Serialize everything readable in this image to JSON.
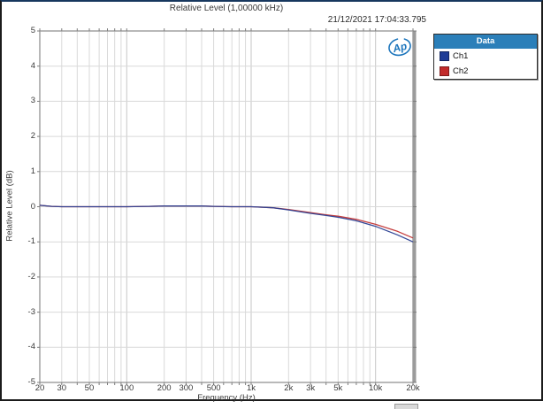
{
  "window": {
    "border_top_color": "#17375e",
    "border_color": "#1b1b1b"
  },
  "header": {
    "title": "Relative Level (1,00000 kHz)",
    "timestamp": "21/12/2021 17:04:33.795"
  },
  "logo": {
    "text": "Ap",
    "color": "#1c75bc"
  },
  "legend": {
    "title": "Data",
    "header_bg": "#2b7fb9",
    "header_color": "#ffffff",
    "items": [
      {
        "label": "Ch1",
        "color": "#1e3c96"
      },
      {
        "label": "Ch2",
        "color": "#c22a2a"
      }
    ]
  },
  "chart_data": {
    "type": "line",
    "title": "Relative Level (1,00000 kHz)",
    "xlabel": "Frequency (Hz)",
    "ylabel": "Relative Level (dB)",
    "x_scale": "log",
    "xlim": [
      20,
      20000
    ],
    "ylim": [
      -5,
      5
    ],
    "grid": true,
    "grid_color": "#d9d9d9",
    "decade_grid_color": "#c6c6c6",
    "frame_color": "#9b9b9b",
    "tick_color": "#7d7d7d",
    "y_ticks": [
      5,
      4,
      3,
      2,
      1,
      0,
      -1,
      -2,
      -3,
      -4,
      -5
    ],
    "x_ticks": [
      {
        "f": 20,
        "label": "20"
      },
      {
        "f": 30,
        "label": "30"
      },
      {
        "f": 50,
        "label": "50"
      },
      {
        "f": 100,
        "label": "100"
      },
      {
        "f": 200,
        "label": "200"
      },
      {
        "f": 300,
        "label": "300"
      },
      {
        "f": 500,
        "label": "500"
      },
      {
        "f": 1000,
        "label": "1k"
      },
      {
        "f": 2000,
        "label": "2k"
      },
      {
        "f": 3000,
        "label": "3k"
      },
      {
        "f": 5000,
        "label": "5k"
      },
      {
        "f": 10000,
        "label": "10k"
      },
      {
        "f": 20000,
        "label": "20k"
      }
    ],
    "x_gridlines": [
      20,
      30,
      40,
      50,
      60,
      70,
      80,
      90,
      100,
      200,
      300,
      400,
      500,
      600,
      700,
      800,
      900,
      1000,
      2000,
      3000,
      4000,
      5000,
      6000,
      7000,
      8000,
      9000,
      10000,
      20000
    ],
    "decade_lines": [
      100,
      1000,
      10000
    ],
    "x": [
      20,
      25,
      30,
      40,
      50,
      70,
      100,
      150,
      200,
      250,
      300,
      400,
      500,
      700,
      1000,
      1500,
      2000,
      3000,
      4000,
      5000,
      7000,
      10000,
      15000,
      20000
    ],
    "series": [
      {
        "name": "Ch2",
        "color": "#c23434",
        "y": [
          0.04,
          0.01,
          0.0,
          0.0,
          0.0,
          0.0,
          0.0,
          0.01,
          0.02,
          0.02,
          0.02,
          0.02,
          0.01,
          0.0,
          0.0,
          -0.03,
          -0.08,
          -0.17,
          -0.23,
          -0.27,
          -0.36,
          -0.5,
          -0.7,
          -0.89
        ]
      },
      {
        "name": "Ch1",
        "color": "#2a3f92",
        "y": [
          0.04,
          0.01,
          0.0,
          0.0,
          0.0,
          0.0,
          0.0,
          0.01,
          0.02,
          0.02,
          0.02,
          0.02,
          0.01,
          0.0,
          0.0,
          -0.03,
          -0.09,
          -0.19,
          -0.25,
          -0.3,
          -0.4,
          -0.56,
          -0.8,
          -1.0
        ]
      }
    ]
  }
}
